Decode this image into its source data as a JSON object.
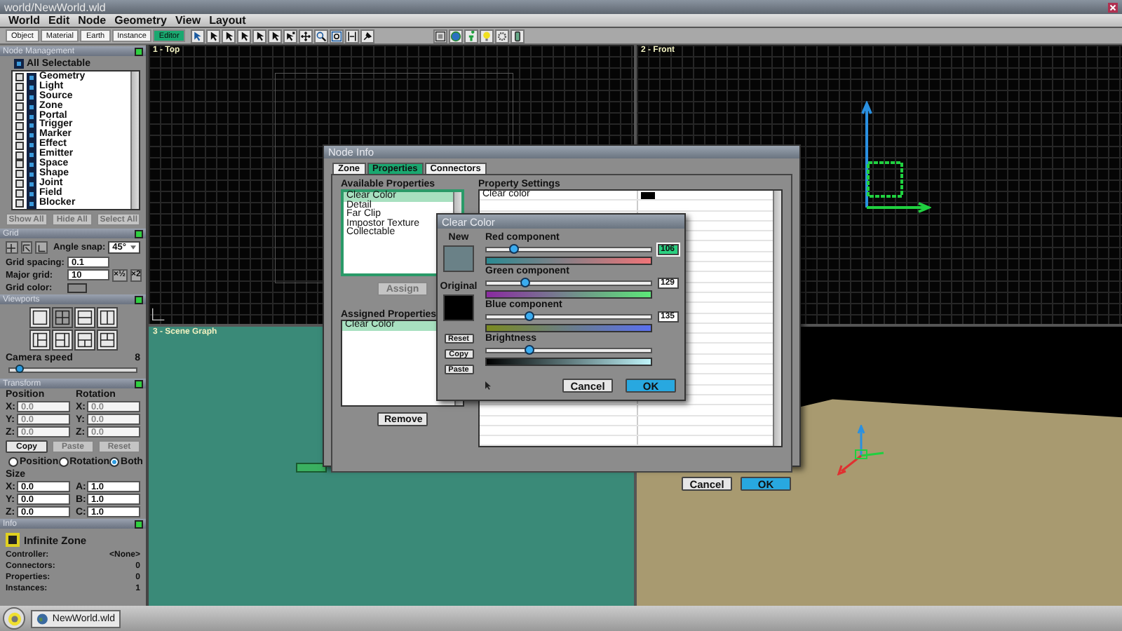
{
  "window": {
    "title": "world/NewWorld.wld"
  },
  "menu": [
    "World",
    "Edit",
    "Node",
    "Geometry",
    "View",
    "Layout"
  ],
  "mode_tabs": [
    {
      "label": "Object",
      "selected": false
    },
    {
      "label": "Material",
      "selected": false
    },
    {
      "label": "Earth",
      "selected": false
    },
    {
      "label": "Instance",
      "selected": false
    },
    {
      "label": "Editor",
      "selected": true
    }
  ],
  "left_panel": {
    "node_management": {
      "title": "Node Management",
      "all_selectable": {
        "label": "All Selectable",
        "checked": true
      },
      "items": [
        {
          "label": "Geometry",
          "checked": true
        },
        {
          "label": "Light",
          "checked": true
        },
        {
          "label": "Source",
          "checked": true
        },
        {
          "label": "Zone",
          "checked": true
        },
        {
          "label": "Portal",
          "checked": true
        },
        {
          "label": "Trigger",
          "checked": true
        },
        {
          "label": "Marker",
          "checked": true
        },
        {
          "label": "Effect",
          "checked": true
        },
        {
          "label": "Emitter",
          "checked": true
        },
        {
          "label": "Space",
          "checked": true
        },
        {
          "label": "Shape",
          "checked": true
        },
        {
          "label": "Joint",
          "checked": true
        },
        {
          "label": "Field",
          "checked": true
        },
        {
          "label": "Blocker",
          "checked": true
        }
      ],
      "buttons": [
        {
          "label": "Show All",
          "disabled": true
        },
        {
          "label": "Hide All",
          "disabled": true
        },
        {
          "label": "Select All",
          "disabled": true
        }
      ]
    },
    "grid": {
      "title": "Grid",
      "angle_snap": {
        "label": "Angle snap:",
        "value": "45°"
      },
      "fields": [
        {
          "label": "Grid spacing:",
          "value": "0.1"
        },
        {
          "label": "Major grid:",
          "value": "10"
        }
      ],
      "grid_color": {
        "label": "Grid color:"
      },
      "scale_buttons": [
        "×½",
        "×2"
      ]
    },
    "viewports": {
      "title": "Viewports",
      "camera_speed": {
        "label": "Camera speed",
        "reading": "8",
        "level": 0.08
      }
    },
    "transform": {
      "title": "Transform",
      "position": {
        "label": "Position",
        "fields": [
          {
            "axis": "X:",
            "value": "0.0",
            "disabled": true
          },
          {
            "axis": "Y:",
            "value": "0.0",
            "disabled": true
          },
          {
            "axis": "Z:",
            "value": "0.0",
            "disabled": true
          }
        ]
      },
      "rotation": {
        "label": "Rotation",
        "fields": [
          {
            "axis": "X:",
            "value": "0.0",
            "disabled": true
          },
          {
            "axis": "Y:",
            "value": "0.0",
            "disabled": true
          },
          {
            "axis": "Z:",
            "value": "0.0",
            "disabled": true
          }
        ]
      },
      "buttons": [
        {
          "label": "Copy",
          "disabled": false
        },
        {
          "label": "Paste",
          "disabled": true
        },
        {
          "label": "Reset",
          "disabled": true
        }
      ],
      "apply_to": [
        {
          "label": "Position",
          "selected": false
        },
        {
          "label": "Rotation",
          "selected": false
        },
        {
          "label": "Both",
          "selected": true
        }
      ],
      "size": {
        "label": "Size",
        "fields": [
          {
            "axis": "X:",
            "value": "0.0"
          },
          {
            "axis": "A:",
            "value": "1.0"
          },
          {
            "axis": "Y:",
            "value": "0.0"
          },
          {
            "axis": "B:",
            "value": "1.0"
          },
          {
            "axis": "Z:",
            "value": "0.0"
          },
          {
            "axis": "C:",
            "value": "1.0"
          }
        ]
      }
    },
    "info": {
      "title": "Info",
      "name": "Infinite Zone",
      "rows": [
        {
          "label": "Controller:",
          "value": "<None>"
        },
        {
          "label": "Connectors:",
          "value": "0"
        },
        {
          "label": "Properties:",
          "value": "0"
        },
        {
          "label": "Instances:",
          "value": "1"
        }
      ]
    }
  },
  "viewports": [
    {
      "label": "1 - Top",
      "kind": "top"
    },
    {
      "label": "2 - Front",
      "kind": "front"
    },
    {
      "label": "3 - Scene Graph",
      "kind": "graph"
    },
    {
      "kind": "perspective"
    }
  ],
  "node_info": {
    "title": "Node Info",
    "tabs": [
      {
        "label": "Zone",
        "selected": false
      },
      {
        "label": "Properties",
        "selected": true
      },
      {
        "label": "Connectors",
        "selected": false
      }
    ],
    "available": {
      "label": "Available Properties",
      "items": [
        {
          "label": "Clear Color",
          "selected": true
        },
        {
          "label": "Detail",
          "selected": false
        },
        {
          "label": "Far Clip",
          "selected": false
        },
        {
          "label": "Impostor Texture",
          "selected": false
        },
        {
          "label": "Collectable",
          "selected": false
        }
      ]
    },
    "assign": {
      "label": "Assign",
      "disabled": true
    },
    "assigned": {
      "label": "Assigned Properties",
      "items": [
        {
          "label": "Clear Color",
          "selected": true
        }
      ]
    },
    "remove": {
      "label": "Remove",
      "disabled": false
    },
    "settings": {
      "label": "Property Settings",
      "rows": [
        {
          "name": "Clear color"
        }
      ]
    },
    "buttons": [
      "Cancel",
      "OK"
    ]
  },
  "clear_color": {
    "title": "Clear Color",
    "new_label": "New",
    "original_label": "Original",
    "side_buttons": [
      "Reset",
      "Copy",
      "Paste"
    ],
    "sliders": [
      {
        "kind": "red",
        "label": "Red component",
        "level": 0.16,
        "value": "106",
        "focused": true
      },
      {
        "kind": "green",
        "label": "Green component",
        "level": 0.23,
        "value": "129",
        "focused": false
      },
      {
        "kind": "blue",
        "label": "Blue component",
        "level": 0.26,
        "value": "135",
        "focused": false
      },
      {
        "kind": "brightness",
        "label": "Brightness",
        "level": 0.26
      }
    ],
    "buttons": [
      "Cancel",
      "OK"
    ]
  },
  "taskbar": {
    "task": "NewWorld.wld"
  }
}
